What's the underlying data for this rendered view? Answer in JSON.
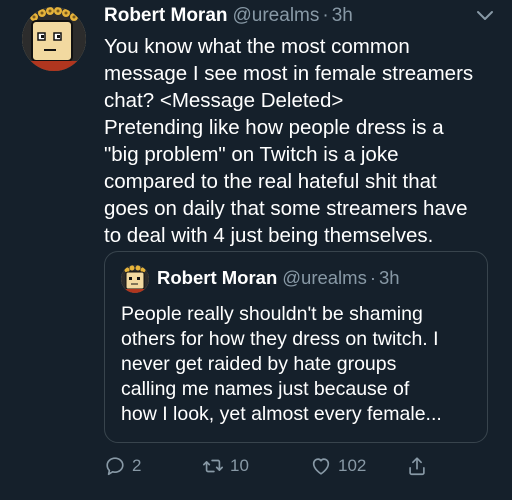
{
  "colors": {
    "background": "#15202b",
    "text": "#ffffff",
    "secondary": "#8899a6",
    "border": "#38444d"
  },
  "tweet": {
    "display_name": "Robert Moran",
    "handle": "@urealms",
    "separator": "·",
    "time": "3h",
    "avatar_icon": "cartoon-avatar-with-flower-crown-icon",
    "menu_icon": "chevron-down-icon",
    "lines": [
      "You know what the most common",
      "message I see most in female streamers",
      "chat? <Message Deleted>",
      "Pretending like how people dress is a",
      "\"big problem\" on Twitch is a joke",
      "compared to the real hateful shit that",
      "goes on daily that some streamers have",
      "to deal with 4 just being themselves."
    ]
  },
  "quoted_tweet": {
    "display_name": "Robert Moran",
    "handle": "@urealms",
    "separator": "·",
    "time": "3h",
    "avatar_icon": "cartoon-avatar-icon",
    "lines": [
      "People really shouldn't be shaming",
      "others for how they dress on twitch. I",
      "never get raided by hate groups",
      "calling me names just because of",
      "how I look, yet almost every female..."
    ]
  },
  "actions": {
    "reply": {
      "icon": "reply-icon",
      "count": "2"
    },
    "retweet": {
      "icon": "retweet-icon",
      "count": "10"
    },
    "like": {
      "icon": "heart-icon",
      "count": "102"
    },
    "share": {
      "icon": "share-icon"
    }
  }
}
